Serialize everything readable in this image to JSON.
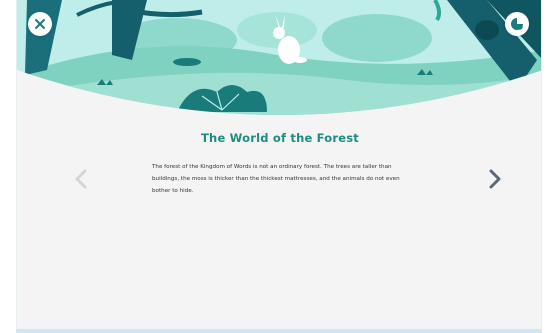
{
  "story": {
    "title": "The World of the Forest",
    "paragraph": "The forest of the Kingdom of Words is not an ordinary forest. The trees are taller than buildings, the moss is thicker than the thickest mattresses, and the animals do not even bother to hide."
  },
  "icons": {
    "close": "close-icon",
    "audio": "audio-toggle-icon",
    "prev": "chevron-left-icon",
    "next": "chevron-right-icon"
  },
  "colors": {
    "accent": "#1e8c82",
    "icon_teal": "#1a7c7a",
    "chevron_disabled": "#cfd6dc",
    "chevron_active": "#5e6a73"
  }
}
